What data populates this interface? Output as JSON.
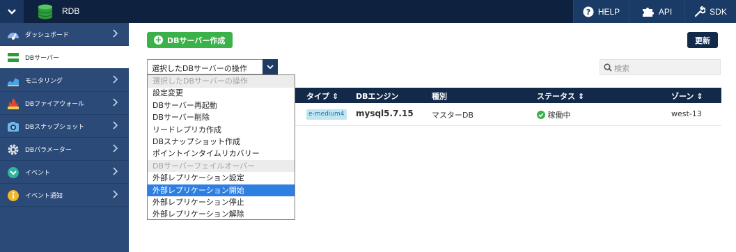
{
  "app": {
    "title": "RDB",
    "icons": {
      "menu_toggle": "chevron-down-icon",
      "logo": "database-icon"
    }
  },
  "topbar": {
    "buttons": [
      {
        "label": "HELP",
        "icon": "help-circle-icon"
      },
      {
        "label": "API",
        "icon": "puzzle-icon"
      },
      {
        "label": "SDK",
        "icon": "wrench-icon"
      }
    ]
  },
  "sidebar": {
    "items": [
      {
        "label": "ダッシュボード",
        "icon": "dashboard-icon",
        "active": false
      },
      {
        "label": "DBサーバー",
        "icon": "server-icon",
        "active": true
      },
      {
        "label": "モニタリング",
        "icon": "monitoring-icon",
        "active": false
      },
      {
        "label": "DBファイアウォール",
        "icon": "firewall-icon",
        "active": false
      },
      {
        "label": "DBスナップショット",
        "icon": "camera-icon",
        "active": false
      },
      {
        "label": "DBパラメーター",
        "icon": "gear-icon",
        "active": false
      },
      {
        "label": "イベント",
        "icon": "event-icon",
        "active": false
      },
      {
        "label": "イベント通知",
        "icon": "info-icon",
        "active": false
      }
    ]
  },
  "toolbar": {
    "create_label": "DBサーバー作成",
    "refresh_label": "更新",
    "action_select_value": "選択したDBサーバーの操作",
    "search_placeholder": "検索"
  },
  "dropdown": {
    "options": [
      {
        "label": "選択したDBサーバーの操作",
        "state": "disabled"
      },
      {
        "label": "設定変更",
        "state": "normal"
      },
      {
        "label": "DBサーバー再起動",
        "state": "normal"
      },
      {
        "label": "DBサーバー削除",
        "state": "normal"
      },
      {
        "label": "リードレプリカ作成",
        "state": "normal"
      },
      {
        "label": "DBスナップショット作成",
        "state": "normal"
      },
      {
        "label": "ポイントインタイムリカバリー",
        "state": "normal"
      },
      {
        "label": "DBサーバーフェイルオーバー",
        "state": "disabled"
      },
      {
        "label": "外部レプリケーション設定",
        "state": "normal"
      },
      {
        "label": "外部レプリケーション開始",
        "state": "selected"
      },
      {
        "label": "外部レプリケーション停止",
        "state": "normal"
      },
      {
        "label": "外部レプリケーション解除",
        "state": "normal"
      }
    ]
  },
  "table": {
    "headers": {
      "type": "タイプ",
      "engine": "DBエンジン",
      "role": "種別",
      "status": "ステータス",
      "zone": "ゾーン"
    },
    "rows": [
      {
        "type": "e-medium4",
        "engine": "mysql5.7.15",
        "role": "マスターDB",
        "status": "稼働中",
        "zone": "west-13"
      }
    ]
  },
  "colors": {
    "topbar": "#0e2240",
    "sidebar": "#2b4a78",
    "create_button": "#3bb14a",
    "header": "#13294a",
    "selected_option": "#2f7fe2",
    "status_ok": "#3bb14a"
  }
}
